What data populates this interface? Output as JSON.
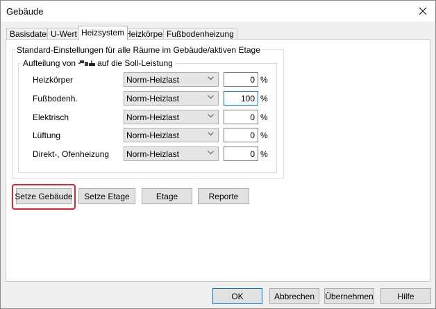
{
  "window": {
    "title": "Gebäude"
  },
  "tabs": [
    {
      "label": "Basisdaten",
      "active": false
    },
    {
      "label": "U-Wert",
      "active": false
    },
    {
      "label": "Heizsystem",
      "active": true
    },
    {
      "label": "Heizkörper",
      "active": false
    },
    {
      "label": "Fußbodenheizung",
      "active": false
    }
  ],
  "group": {
    "title": "Standard-Einstellungen für alle Räume im Gebäude/aktiven Etage",
    "subgroup_prefix": "Aufteilung von",
    "subgroup_suffix": "auf die Soll-Leistung",
    "rows": [
      {
        "label": "Heizkörper",
        "mode": "Norm-Heizlast",
        "value": "0",
        "unit": "%"
      },
      {
        "label": "Fußbodenh.",
        "mode": "Norm-Heizlast",
        "value": "100",
        "unit": "%"
      },
      {
        "label": "Elektrisch",
        "mode": "Norm-Heizlast",
        "value": "0",
        "unit": "%"
      },
      {
        "label": "Lüftung",
        "mode": "Norm-Heizlast",
        "value": "0",
        "unit": "%"
      },
      {
        "label": "Direkt-, Ofenheizung",
        "mode": "Norm-Heizlast",
        "value": "0",
        "unit": "%"
      }
    ]
  },
  "action_buttons": {
    "setze_gebaeude": "Setze Gebäude",
    "setze_etage": "Setze Etage",
    "etage": "Etage",
    "reporte": "Reporte"
  },
  "footer_buttons": {
    "ok": "OK",
    "cancel": "Abbrechen",
    "apply": "Übernehmen",
    "help": "Hilfe"
  },
  "highlight_color": "#e0262b",
  "accent_color": "#0078d7"
}
